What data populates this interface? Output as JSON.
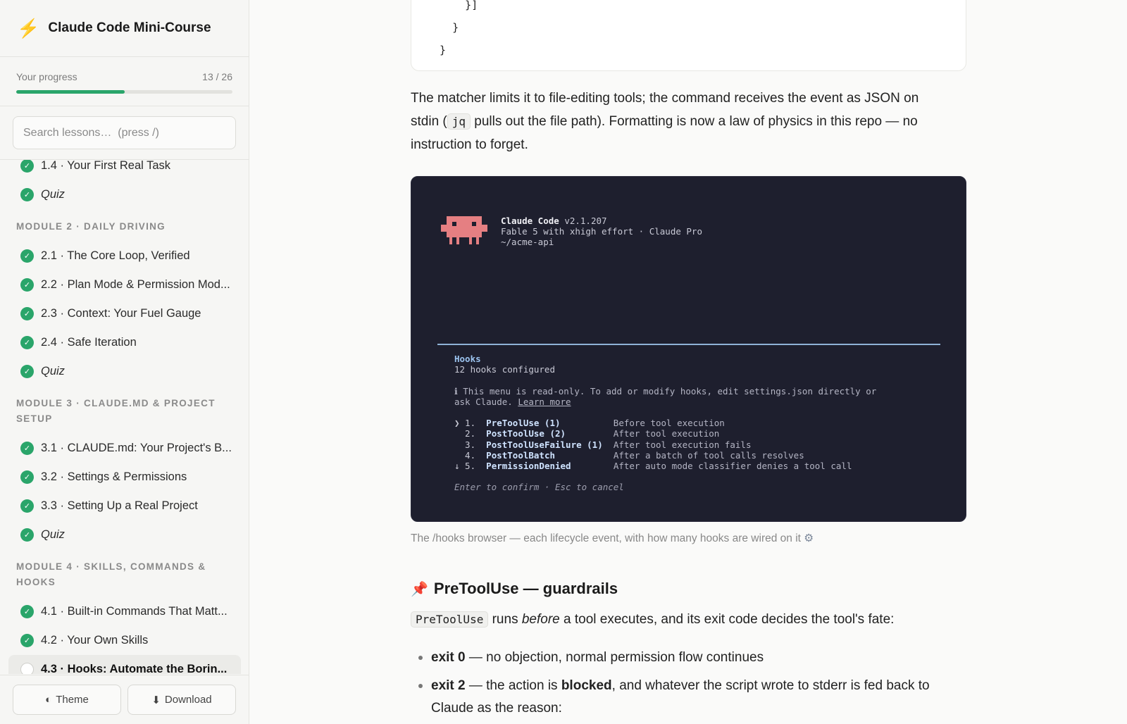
{
  "app": {
    "title": "Claude Code Mini-Course",
    "brand_icon": "lightning-bolt-icon"
  },
  "progress": {
    "label": "Your progress",
    "count": "13 / 26",
    "fraction": 0.5,
    "color": "#2aa56a"
  },
  "search": {
    "placeholder": "Search lessons…  (press /)"
  },
  "sidebar": {
    "items": [
      {
        "type": "lesson",
        "label": "1.4 · Your First Real Task",
        "done": true
      },
      {
        "type": "quiz",
        "label": "Quiz",
        "done": true
      },
      {
        "type": "module",
        "label": "MODULE 2 · DAILY DRIVING"
      },
      {
        "type": "lesson",
        "label": "2.1 · The Core Loop, Verified",
        "done": true
      },
      {
        "type": "lesson",
        "label": "2.2 · Plan Mode & Permission Mod...",
        "done": true
      },
      {
        "type": "lesson",
        "label": "2.3 · Context: Your Fuel Gauge",
        "done": true
      },
      {
        "type": "lesson",
        "label": "2.4 · Safe Iteration",
        "done": true
      },
      {
        "type": "quiz",
        "label": "Quiz",
        "done": true
      },
      {
        "type": "module",
        "label": "MODULE 3 · CLAUDE.MD & PROJECT SETUP"
      },
      {
        "type": "lesson",
        "label": "3.1 · CLAUDE.md: Your Project's B...",
        "done": true
      },
      {
        "type": "lesson",
        "label": "3.2 · Settings & Permissions",
        "done": true
      },
      {
        "type": "lesson",
        "label": "3.3 · Setting Up a Real Project",
        "done": true
      },
      {
        "type": "quiz",
        "label": "Quiz",
        "done": true
      },
      {
        "type": "module",
        "label": "MODULE 4 · SKILLS, COMMANDS & HOOKS"
      },
      {
        "type": "lesson",
        "label": "4.1 · Built-in Commands That Matt...",
        "done": true
      },
      {
        "type": "lesson",
        "label": "4.2 · Your Own Skills",
        "done": true
      },
      {
        "type": "lesson",
        "label": "4.3 · Hooks: Automate the Borin...",
        "done": false,
        "active": true
      }
    ],
    "footer": {
      "theme_label": "Theme",
      "theme_icon": "half-circle-icon",
      "download_label": "Download",
      "download_icon": "download-arrow-icon"
    }
  },
  "content": {
    "code_tail": "      }]\n    }\n  }",
    "para1_a": "The matcher limits it to file-editing tools; the command receives the event as JSON on stdin (",
    "para1_code": "jq",
    "para1_b": " pulls out the file path). Formatting is now a law of physics in this repo — no instruction to forget.",
    "terminal": {
      "app_name": "Claude Code",
      "version": "v2.1.207",
      "model_line": "Fable 5 with xhigh effort · Claude Pro",
      "path": "~/acme-api",
      "hooks_title": "Hooks",
      "hooks_count": "12 hooks configured",
      "info_a": "ℹ This menu is read-only. To add or modify hooks, edit settings.json directly or",
      "info_b": "ask Claude. ",
      "learn_more": "Learn more",
      "events": [
        {
          "marker": "❯ 1.",
          "name": "PreToolUse (1)",
          "desc": "Before tool execution"
        },
        {
          "marker": "  2.",
          "name": "PostToolUse (2)",
          "desc": "After tool execution"
        },
        {
          "marker": "  3.",
          "name": "PostToolUseFailure (1)",
          "desc": "After tool execution fails"
        },
        {
          "marker": "  4.",
          "name": "PostToolBatch",
          "desc": "After a batch of tool calls resolves"
        },
        {
          "marker": "↓ 5.",
          "name": "PermissionDenied",
          "desc": "After auto mode classifier denies a tool call"
        }
      ],
      "footer_hint": "Enter to confirm · Esc to cancel"
    },
    "caption": "The /hooks browser — each lifecycle event, with how many hooks are wired on it",
    "caption_icon": "gear-icon",
    "section_icon": "pushpin-icon",
    "section_title": "PreToolUse — guardrails",
    "p2_code": "PreToolUse",
    "p2_a": " runs ",
    "p2_em": "before",
    "p2_b": " a tool executes, and its exit code decides the tool's fate:",
    "bullets": [
      {
        "strong": "exit 0",
        "text": " — no objection, normal permission flow continues"
      },
      {
        "strong": "exit 2",
        "text_a": " — the action is ",
        "strong2": "blocked",
        "text_b": ", and whatever the script wrote to stderr is fed back to Claude as the reason:"
      }
    ]
  }
}
